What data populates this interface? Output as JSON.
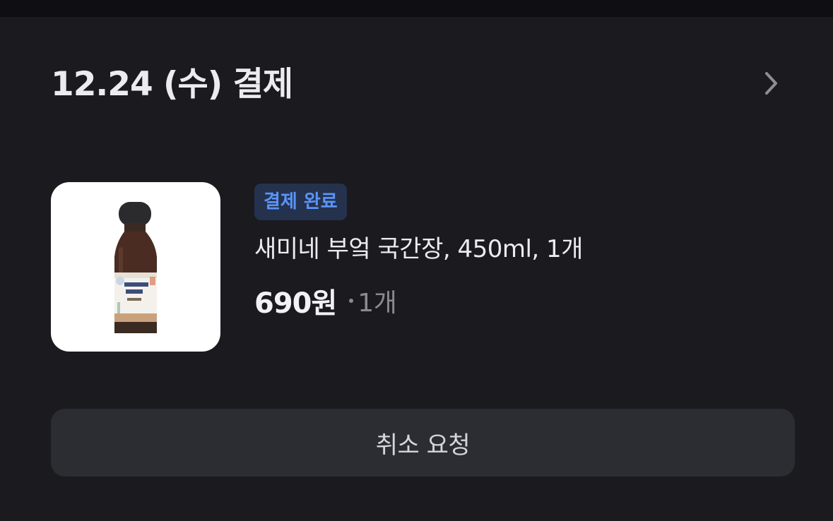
{
  "order": {
    "date_title": "12.24 (수) 결제",
    "status_badge": "결제 완료",
    "product_name": "새미네 부엌 국간장, 450ml, 1개",
    "price": "690원",
    "quantity": "1개",
    "cancel_label": "취소 요청",
    "product_image_label": "새미네 부엌 국간장"
  },
  "colors": {
    "background": "#1a1a1f",
    "badge_bg": "#24324d",
    "badge_text": "#5b93f7",
    "button_bg": "#2c2c33"
  }
}
